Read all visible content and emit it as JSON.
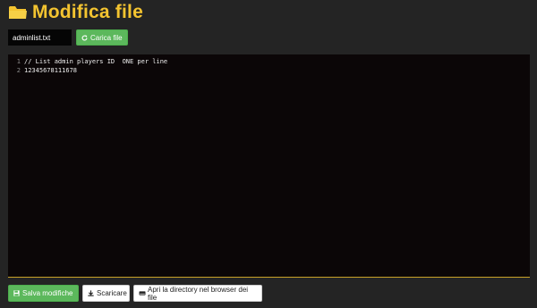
{
  "header": {
    "title": "Modifica file",
    "icon": "folder-icon",
    "accent_color": "#f4c430"
  },
  "file_controls": {
    "filename_value": "adminlist.txt",
    "load_button_label": "Carica file",
    "load_button_icon": "refresh-icon"
  },
  "editor": {
    "line_numbers": [
      "1",
      "2"
    ],
    "lines": [
      "// List admin players ID  ONE per line",
      "12345678111678"
    ]
  },
  "actions": {
    "save_label": "Salva modifiche",
    "save_icon": "save-icon",
    "download_label": "Scaricare",
    "download_icon": "download-icon",
    "open_dir_label": "Apri la directory nel browser dei file",
    "open_dir_icon": "drive-icon"
  },
  "colors": {
    "background": "#242424",
    "editor_background": "#0b0607",
    "green": "#5cb85c",
    "editor_border": "#c9a227"
  }
}
